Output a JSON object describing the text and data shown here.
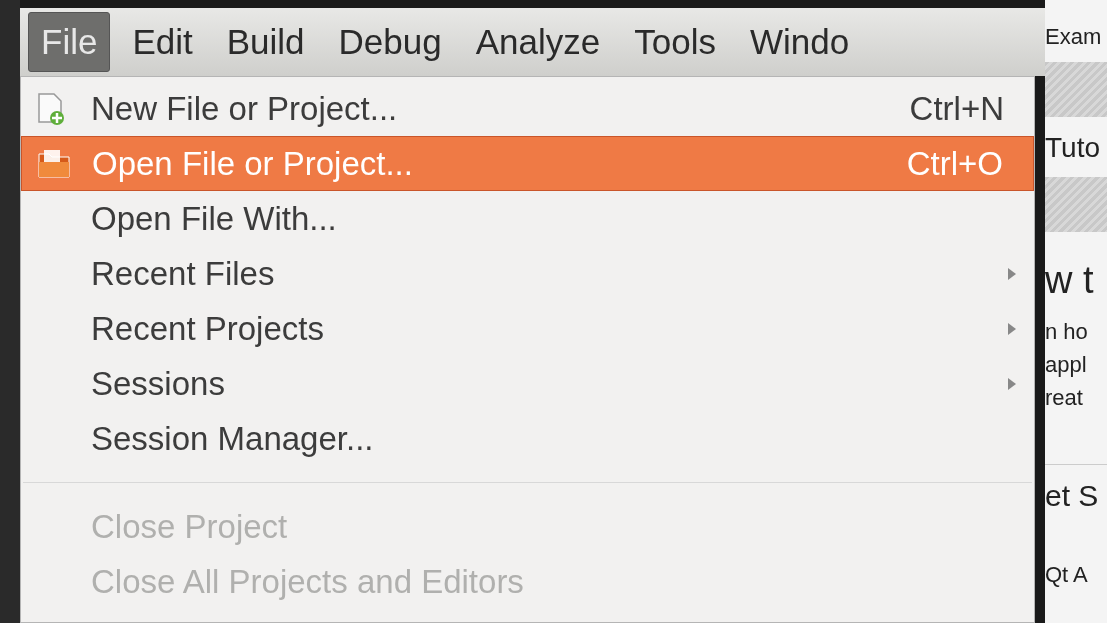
{
  "menubar": [
    {
      "label": "File",
      "selected": true
    },
    {
      "label": "Edit",
      "selected": false
    },
    {
      "label": "Build",
      "selected": false
    },
    {
      "label": "Debug",
      "selected": false
    },
    {
      "label": "Analyze",
      "selected": false
    },
    {
      "label": "Tools",
      "selected": false
    },
    {
      "label": "Windo",
      "selected": false
    }
  ],
  "menu": {
    "items": [
      {
        "kind": "new",
        "label": "New File or Project...",
        "shortcut": "Ctrl+N",
        "selected": false,
        "disabled": false,
        "submenu": false
      },
      {
        "kind": "open",
        "label": "Open File or Project...",
        "shortcut": "Ctrl+O",
        "selected": true,
        "disabled": false,
        "submenu": false
      },
      {
        "kind": "item",
        "label": "Open File With...",
        "selected": false,
        "disabled": false,
        "submenu": false
      },
      {
        "kind": "item",
        "label": "Recent Files",
        "selected": false,
        "disabled": false,
        "submenu": true
      },
      {
        "kind": "item",
        "label": "Recent Projects",
        "selected": false,
        "disabled": false,
        "submenu": true
      },
      {
        "kind": "item",
        "label": "Sessions",
        "selected": false,
        "disabled": false,
        "submenu": true
      },
      {
        "kind": "item",
        "label": "Session Manager...",
        "selected": false,
        "disabled": false,
        "submenu": false
      },
      {
        "kind": "separator"
      },
      {
        "kind": "item",
        "label": "Close Project",
        "selected": false,
        "disabled": true,
        "submenu": false
      },
      {
        "kind": "item",
        "label": "Close All Projects and Editors",
        "selected": false,
        "disabled": true,
        "submenu": false
      }
    ]
  },
  "background_panel": {
    "texts": [
      "Exam",
      "Tuto",
      "w t",
      "n ho",
      "appl",
      "reat",
      "et S",
      "Qt A"
    ]
  }
}
